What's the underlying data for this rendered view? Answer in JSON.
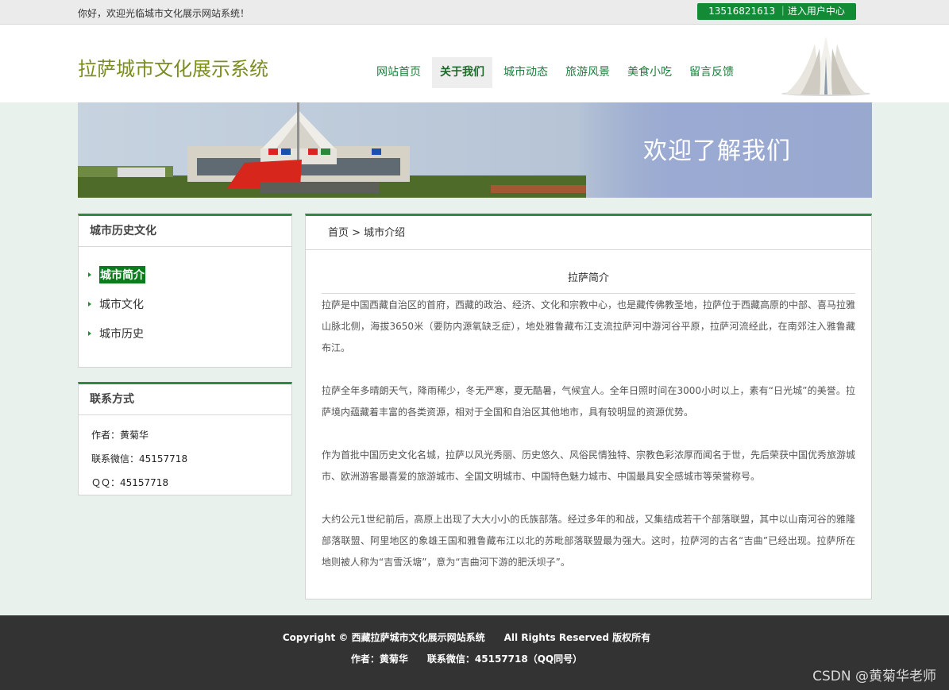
{
  "topbar": {
    "greeting": "你好，欢迎光临城市文化展示网站系统！",
    "user_center": "13516821613 ｜进入用户中心"
  },
  "header": {
    "logo": "拉萨城市文化展示系统",
    "nav": [
      {
        "label": "网站首页",
        "active": false
      },
      {
        "label": "关于我们",
        "active": true
      },
      {
        "label": "城市动态",
        "active": false
      },
      {
        "label": "旅游风景",
        "active": false
      },
      {
        "label": "美食小吃",
        "active": false
      },
      {
        "label": "留言反馈",
        "active": false
      }
    ]
  },
  "banner": {
    "title": "欢迎了解我们"
  },
  "sidebar": {
    "history": {
      "title": "城市历史文化",
      "items": [
        {
          "label": "城市简介",
          "active": true
        },
        {
          "label": "城市文化",
          "active": false
        },
        {
          "label": "城市历史",
          "active": false
        }
      ]
    },
    "contact": {
      "title": "联系方式",
      "author": "作者：黄菊华",
      "wechat": "联系微信：45157718",
      "qq": "ＱＱ：45157718"
    }
  },
  "main": {
    "breadcrumb": "首页 > 城市介绍",
    "article_title": "拉萨简介",
    "paragraphs": [
      "拉萨是中国西藏自治区的首府，西藏的政治、经济、文化和宗教中心，也是藏传佛教圣地，拉萨位于西藏高原的中部、喜马拉雅山脉北侧，海拔3650米（要防内源氧缺乏症），地处雅鲁藏布江支流拉萨河中游河谷平原，拉萨河流经此，在南郊注入雅鲁藏布江。",
      "拉萨全年多晴朗天气，降雨稀少，冬无严寒，夏无酷暑，气候宜人。全年日照时间在3000小时以上，素有“日光城”的美誉。拉萨境内蕴藏着丰富的各类资源，相对于全国和自治区其他地市，具有较明显的资源优势。",
      "作为首批中国历史文化名城，拉萨以风光秀丽、历史悠久、风俗民情独特、宗教色彩浓厚而闻名于世，先后荣获中国优秀旅游城市、欧洲游客最喜爱的旅游城市、全国文明城市、中国特色魅力城市、中国最具安全感城市等荣誉称号。",
      "大约公元1世纪前后，高原上出现了大大小小的氏族部落。经过多年的和战，又集结成若干个部落联盟，其中以山南河谷的雅隆部落联盟、阿里地区的象雄王国和雅鲁藏布江以北的苏毗部落联盟最为强大。这时，拉萨河的古名“吉曲”已经出现。拉萨所在地则被人称为“吉雪沃塘”，意为“吉曲河下游的肥沃坝子”。"
    ]
  },
  "footer": {
    "line1": "Copyright © 西藏拉萨城市文化展示网站系统　　All Rights Reserved 版权所有",
    "line2": "作者：黄菊华　　联系微信：45157718（QQ同号）",
    "watermark": "CSDN @黄菊华老师"
  },
  "colors": {
    "accent_green": "#138a36",
    "logo_olive": "#7a8e1e",
    "footer_bg": "#333333",
    "page_bg": "#e8f1ec"
  }
}
